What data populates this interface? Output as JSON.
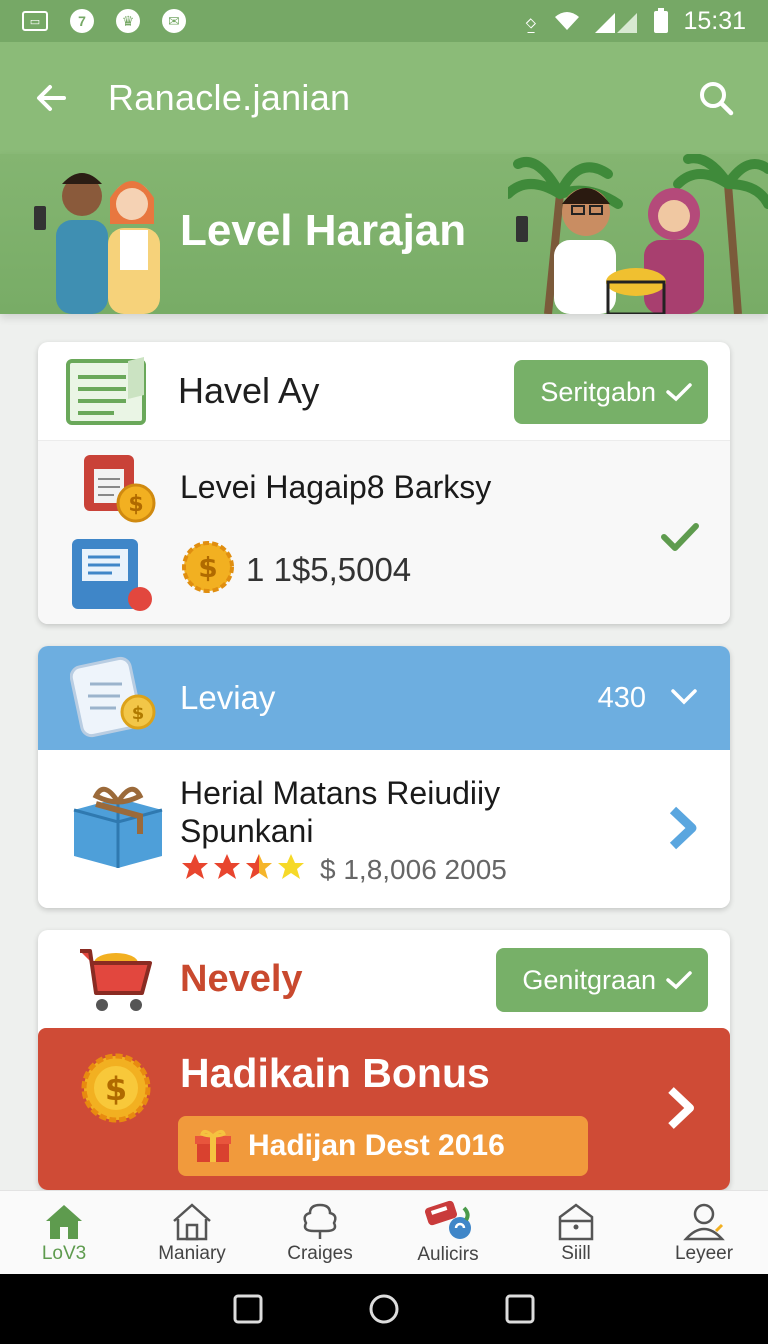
{
  "status_bar": {
    "time": "15:31"
  },
  "app_bar": {
    "title": "Ranacle.janian"
  },
  "hero": {
    "title": "Level Harajan"
  },
  "card1": {
    "title": "Havel Ay",
    "button_label": "Seritgabn",
    "item_title": "Levei Hagaip8 Barksy",
    "amount": "1 1$5,5004"
  },
  "card2": {
    "title": "Leviay",
    "count": "430",
    "item_title_line1": "Herial Matans Reiudiiy",
    "item_title_line2": "Spunkani",
    "rating": 3.5,
    "price": "$ 1,8,006 2005"
  },
  "card3": {
    "title": "Nevely",
    "button_label": "Genitgraan",
    "bonus_title": "Hadikain Bonus",
    "bonus_pill": "Hadijan Dest 2016"
  },
  "bottom_nav": [
    {
      "label": "LoV3",
      "icon": "home-icon",
      "active": true
    },
    {
      "label": "Maniary",
      "icon": "house-outline-icon",
      "active": false
    },
    {
      "label": "Craiges",
      "icon": "tree-icon",
      "active": false
    },
    {
      "label": "Aulicirs",
      "icon": "gift-icon",
      "active": false
    },
    {
      "label": "Siill",
      "icon": "bag-icon",
      "active": false
    },
    {
      "label": "Leyeer",
      "icon": "profile-icon",
      "active": false
    }
  ],
  "colors": {
    "accent_green": "#77b068",
    "app_bar": "#8bbb78",
    "blue_header": "#6daee0",
    "bonus_red": "#cf4b36",
    "pill_orange": "#f19a3c"
  }
}
